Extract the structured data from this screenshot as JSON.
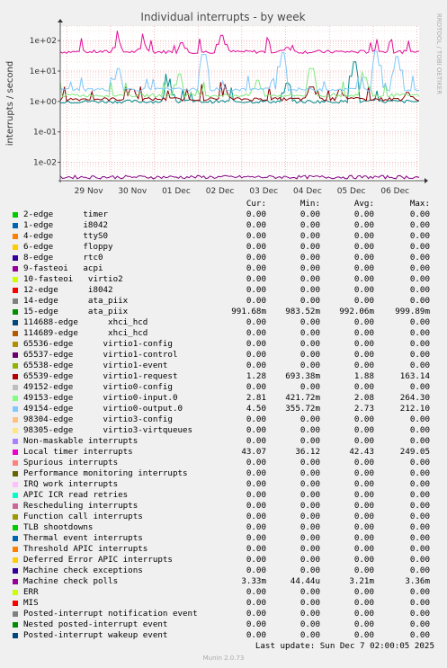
{
  "chart_data": {
    "type": "line",
    "title": "Individual interrupts - by week",
    "ylabel": "interrupts / second",
    "yscale": "log",
    "ylim": [
      0.0025,
      300
    ],
    "yticks": [
      "1e+02",
      "1e+01",
      "1e+00",
      "1e-01",
      "1e-02"
    ],
    "x_categories": [
      "29 Nov",
      "30 Nov",
      "01 Dec",
      "02 Dec",
      "03 Dec",
      "04 Dec",
      "05 Dec",
      "06 Dec"
    ],
    "grid": true,
    "side_text": "RRDTOOL / TOBI OETIKER",
    "series": [
      {
        "name": "Local timer interrupts",
        "color": "#e0109a",
        "baseline": 43,
        "spikes": [
          [
            0.16,
            95
          ],
          [
            0.23,
            80
          ],
          [
            0.34,
            85
          ],
          [
            0.45,
            150
          ],
          [
            0.63,
            60
          ],
          [
            0.88,
            48
          ]
        ]
      },
      {
        "name": "ata_piix",
        "color": "#008a8a",
        "baseline": 1.0,
        "spikes": [
          [
            0.3,
            3
          ],
          [
            0.63,
            4
          ],
          [
            0.82,
            20
          ]
        ]
      },
      {
        "name": "virtio1-request",
        "color": "#8b0000",
        "baseline": 1.2,
        "spikes": [
          [
            0.2,
            2.5
          ],
          [
            0.46,
            2
          ],
          [
            0.7,
            3
          ],
          [
            0.78,
            2.5
          ],
          [
            0.97,
            2
          ]
        ]
      },
      {
        "name": "virtio0-input.0",
        "color": "#7fe87f",
        "baseline": 1.6,
        "spikes": [
          [
            0.33,
            8
          ],
          [
            0.55,
            5
          ],
          [
            0.7,
            12
          ],
          [
            0.85,
            6
          ]
        ]
      },
      {
        "name": "virtio0-output.0",
        "color": "#80c8f8",
        "baseline": 2.5,
        "spikes": [
          [
            0.16,
            12
          ],
          [
            0.4,
            35
          ],
          [
            0.62,
            40
          ],
          [
            0.88,
            45
          ],
          [
            0.94,
            30
          ]
        ]
      },
      {
        "name": "Machine check polls",
        "color": "#800080",
        "baseline": 0.0033,
        "spikes": []
      }
    ]
  },
  "legend": {
    "headers": [
      "Cur:",
      "Min:",
      "Avg:",
      "Max:"
    ],
    "rows": [
      {
        "label": "2-edge      timer",
        "color": "#00cc00",
        "cur": "0.00",
        "min": "0.00",
        "avg": "0.00",
        "max": "0.00"
      },
      {
        "label": "1-edge      i8042",
        "color": "#0066b3",
        "cur": "0.00",
        "min": "0.00",
        "avg": "0.00",
        "max": "0.00"
      },
      {
        "label": "4-edge      ttyS0",
        "color": "#ff8000",
        "cur": "0.00",
        "min": "0.00",
        "avg": "0.00",
        "max": "0.00"
      },
      {
        "label": "6-edge      floppy",
        "color": "#ffcc00",
        "cur": "0.00",
        "min": "0.00",
        "avg": "0.00",
        "max": "0.00"
      },
      {
        "label": "8-edge      rtc0",
        "color": "#330099",
        "cur": "0.00",
        "min": "0.00",
        "avg": "0.00",
        "max": "0.00"
      },
      {
        "label": "9-fasteoi   acpi",
        "color": "#990099",
        "cur": "0.00",
        "min": "0.00",
        "avg": "0.00",
        "max": "0.00"
      },
      {
        "label": "10-fasteoi   virtio2",
        "color": "#ccff00",
        "cur": "0.00",
        "min": "0.00",
        "avg": "0.00",
        "max": "0.00"
      },
      {
        "label": "12-edge      i8042",
        "color": "#ff0000",
        "cur": "0.00",
        "min": "0.00",
        "avg": "0.00",
        "max": "0.00"
      },
      {
        "label": "14-edge      ata_piix",
        "color": "#808080",
        "cur": "0.00",
        "min": "0.00",
        "avg": "0.00",
        "max": "0.00"
      },
      {
        "label": "15-edge      ata_piix",
        "color": "#008f00",
        "cur": "991.68m",
        "min": "983.52m",
        "avg": "992.06m",
        "max": "999.89m"
      },
      {
        "label": "114688-edge      xhci_hcd",
        "color": "#00487d",
        "cur": "0.00",
        "min": "0.00",
        "avg": "0.00",
        "max": "0.00"
      },
      {
        "label": "114689-edge      xhci_hcd",
        "color": "#b35a00",
        "cur": "0.00",
        "min": "0.00",
        "avg": "0.00",
        "max": "0.00"
      },
      {
        "label": "65536-edge      virtio1-config",
        "color": "#b38f00",
        "cur": "0.00",
        "min": "0.00",
        "avg": "0.00",
        "max": "0.00"
      },
      {
        "label": "65537-edge      virtio1-control",
        "color": "#6b006b",
        "cur": "0.00",
        "min": "0.00",
        "avg": "0.00",
        "max": "0.00"
      },
      {
        "label": "65538-edge      virtio1-event",
        "color": "#8fb300",
        "cur": "0.00",
        "min": "0.00",
        "avg": "0.00",
        "max": "0.00"
      },
      {
        "label": "65539-edge      virtio1-request",
        "color": "#b30000",
        "cur": "1.28",
        "min": "693.38m",
        "avg": "1.88",
        "max": "163.14"
      },
      {
        "label": "49152-edge      virtio0-config",
        "color": "#bebebe",
        "cur": "0.00",
        "min": "0.00",
        "avg": "0.00",
        "max": "0.00"
      },
      {
        "label": "49153-edge      virtio0-input.0",
        "color": "#80ff80",
        "cur": "2.81",
        "min": "421.72m",
        "avg": "2.08",
        "max": "264.30"
      },
      {
        "label": "49154-edge      virtio0-output.0",
        "color": "#80c9ff",
        "cur": "4.50",
        "min": "355.72m",
        "avg": "2.73",
        "max": "212.10"
      },
      {
        "label": "98304-edge      virtio3-config",
        "color": "#ffc080",
        "cur": "0.00",
        "min": "0.00",
        "avg": "0.00",
        "max": "0.00"
      },
      {
        "label": "98305-edge      virtio3-virtqueues",
        "color": "#ffe680",
        "cur": "0.00",
        "min": "0.00",
        "avg": "0.00",
        "max": "0.00"
      },
      {
        "label": "Non-maskable interrupts",
        "color": "#aa80ff",
        "cur": "0.00",
        "min": "0.00",
        "avg": "0.00",
        "max": "0.00"
      },
      {
        "label": "Local timer interrupts",
        "color": "#ee00cc",
        "cur": "43.07",
        "min": "36.12",
        "avg": "42.43",
        "max": "249.05"
      },
      {
        "label": "Spurious interrupts",
        "color": "#ff8080",
        "cur": "0.00",
        "min": "0.00",
        "avg": "0.00",
        "max": "0.00"
      },
      {
        "label": "Performance monitoring interrupts",
        "color": "#666600",
        "cur": "0.00",
        "min": "0.00",
        "avg": "0.00",
        "max": "0.00"
      },
      {
        "label": "IRQ work interrupts",
        "color": "#ffbfff",
        "cur": "0.00",
        "min": "0.00",
        "avg": "0.00",
        "max": "0.00"
      },
      {
        "label": "APIC ICR read retries",
        "color": "#00ffcc",
        "cur": "0.00",
        "min": "0.00",
        "avg": "0.00",
        "max": "0.00"
      },
      {
        "label": "Rescheduling interrupts",
        "color": "#cc6699",
        "cur": "0.00",
        "min": "0.00",
        "avg": "0.00",
        "max": "0.00"
      },
      {
        "label": "Function call interrupts",
        "color": "#999900",
        "cur": "0.00",
        "min": "0.00",
        "avg": "0.00",
        "max": "0.00"
      },
      {
        "label": "TLB shootdowns",
        "color": "#00cc00",
        "cur": "0.00",
        "min": "0.00",
        "avg": "0.00",
        "max": "0.00"
      },
      {
        "label": "Thermal event interrupts",
        "color": "#0066b3",
        "cur": "0.00",
        "min": "0.00",
        "avg": "0.00",
        "max": "0.00"
      },
      {
        "label": "Threshold APIC interrupts",
        "color": "#ff8000",
        "cur": "0.00",
        "min": "0.00",
        "avg": "0.00",
        "max": "0.00"
      },
      {
        "label": "Deferred Error APIC interrupts",
        "color": "#ffcc00",
        "cur": "0.00",
        "min": "0.00",
        "avg": "0.00",
        "max": "0.00"
      },
      {
        "label": "Machine check exceptions",
        "color": "#330099",
        "cur": "0.00",
        "min": "0.00",
        "avg": "0.00",
        "max": "0.00"
      },
      {
        "label": "Machine check polls",
        "color": "#990099",
        "cur": "3.33m",
        "min": "44.44u",
        "avg": "3.21m",
        "max": "3.36m"
      },
      {
        "label": "ERR",
        "color": "#ccff00",
        "cur": "0.00",
        "min": "0.00",
        "avg": "0.00",
        "max": "0.00"
      },
      {
        "label": "MIS",
        "color": "#ff0000",
        "cur": "0.00",
        "min": "0.00",
        "avg": "0.00",
        "max": "0.00"
      },
      {
        "label": "Posted-interrupt notification event",
        "color": "#808080",
        "cur": "0.00",
        "min": "0.00",
        "avg": "0.00",
        "max": "0.00"
      },
      {
        "label": "Nested posted-interrupt event",
        "color": "#008f00",
        "cur": "0.00",
        "min": "0.00",
        "avg": "0.00",
        "max": "0.00"
      },
      {
        "label": "Posted-interrupt wakeup event",
        "color": "#00487d",
        "cur": "0.00",
        "min": "0.00",
        "avg": "0.00",
        "max": "0.00"
      }
    ]
  },
  "footer": "Last update: Sun Dec  7 02:00:05 2025",
  "generator": "Munin 2.0.73"
}
